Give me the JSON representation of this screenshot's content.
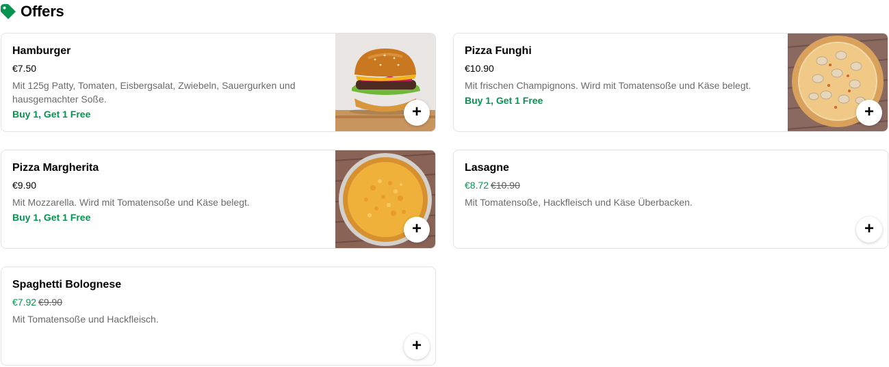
{
  "section": {
    "title": "Offers",
    "icon": "tag-icon",
    "accent": "#05944f"
  },
  "items": [
    {
      "name": "Hamburger",
      "price": "€7.50",
      "description": "Mit 125g Patty, Tomaten, Eisbergsalat, Zwiebeln, Sauergurken und hausgemachter Soße.",
      "promo": "Buy 1, Get 1 Free",
      "image": "burger-photo",
      "add_label": "+"
    },
    {
      "name": "Pizza Funghi",
      "price": "€10.90",
      "description": "Mit frischen Champignons. Wird mit Tomatensoße und Käse belegt.",
      "promo": "Buy 1, Get 1 Free",
      "image": "pizza-funghi-photo",
      "add_label": "+"
    },
    {
      "name": "Pizza Margherita",
      "price": "€9.90",
      "description": "Mit Mozzarella. Wird mit Tomatensoße und Käse belegt.",
      "promo": "Buy 1, Get 1 Free",
      "image": "pizza-margherita-photo",
      "add_label": "+"
    },
    {
      "name": "Lasagne",
      "sale_price": "€8.72",
      "original_price": "€10.90",
      "description": "Mit Tomatensoße, Hackfleisch und Käse Überbacken.",
      "add_label": "+"
    },
    {
      "name": "Spaghetti Bolognese",
      "sale_price": "€7.92",
      "original_price": "€9.90",
      "description": "Mit Tomatensoße und Hackfleisch.",
      "add_label": "+"
    }
  ]
}
